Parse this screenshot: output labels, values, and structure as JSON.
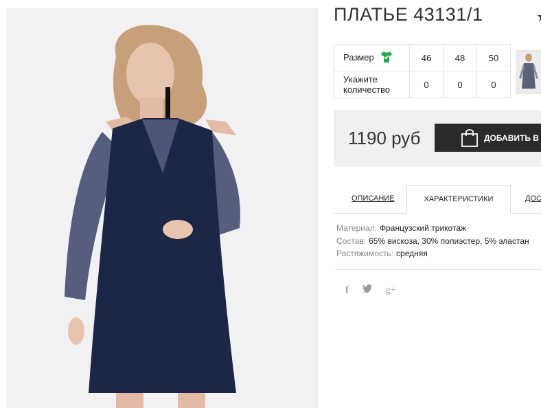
{
  "product": {
    "title": "ПЛАТЬЕ 43131/1",
    "star_icon": "star-icon"
  },
  "sizes": {
    "size_label": "Размер",
    "qty_label_line1": "Укажите",
    "qty_label_line2": "количество",
    "options": [
      "46",
      "48",
      "50"
    ],
    "quantities": [
      "0",
      "0",
      "0"
    ],
    "size_icon": "tshirt-icon",
    "size_icon_color": "#2aa84a"
  },
  "price": {
    "value": "1190 руб",
    "add_button_label": "ДОБАВИТЬ В З"
  },
  "tabs": [
    {
      "label": "ОПИСАНИЕ"
    },
    {
      "label": "ХАРАКТЕРИСТИКИ"
    },
    {
      "label": "ДОС"
    }
  ],
  "active_tab": "ХАРАКТЕРИСТИКИ",
  "specs": [
    {
      "label": "Материал:",
      "value": "Французский трикотаж"
    },
    {
      "label": "Состав:",
      "value": "65% вискоза, 30% полиэстер, 5% эластан"
    },
    {
      "label": "Растяжимость:",
      "value": "средняя"
    }
  ],
  "social": {
    "facebook": "f",
    "twitter": "twitter-icon",
    "googleplus": "g+"
  },
  "colors": {
    "dress": "#1c2647",
    "button_bg": "#2b2b2b",
    "price_bg": "#f0f0f0",
    "icon_green": "#2aa84a"
  }
}
